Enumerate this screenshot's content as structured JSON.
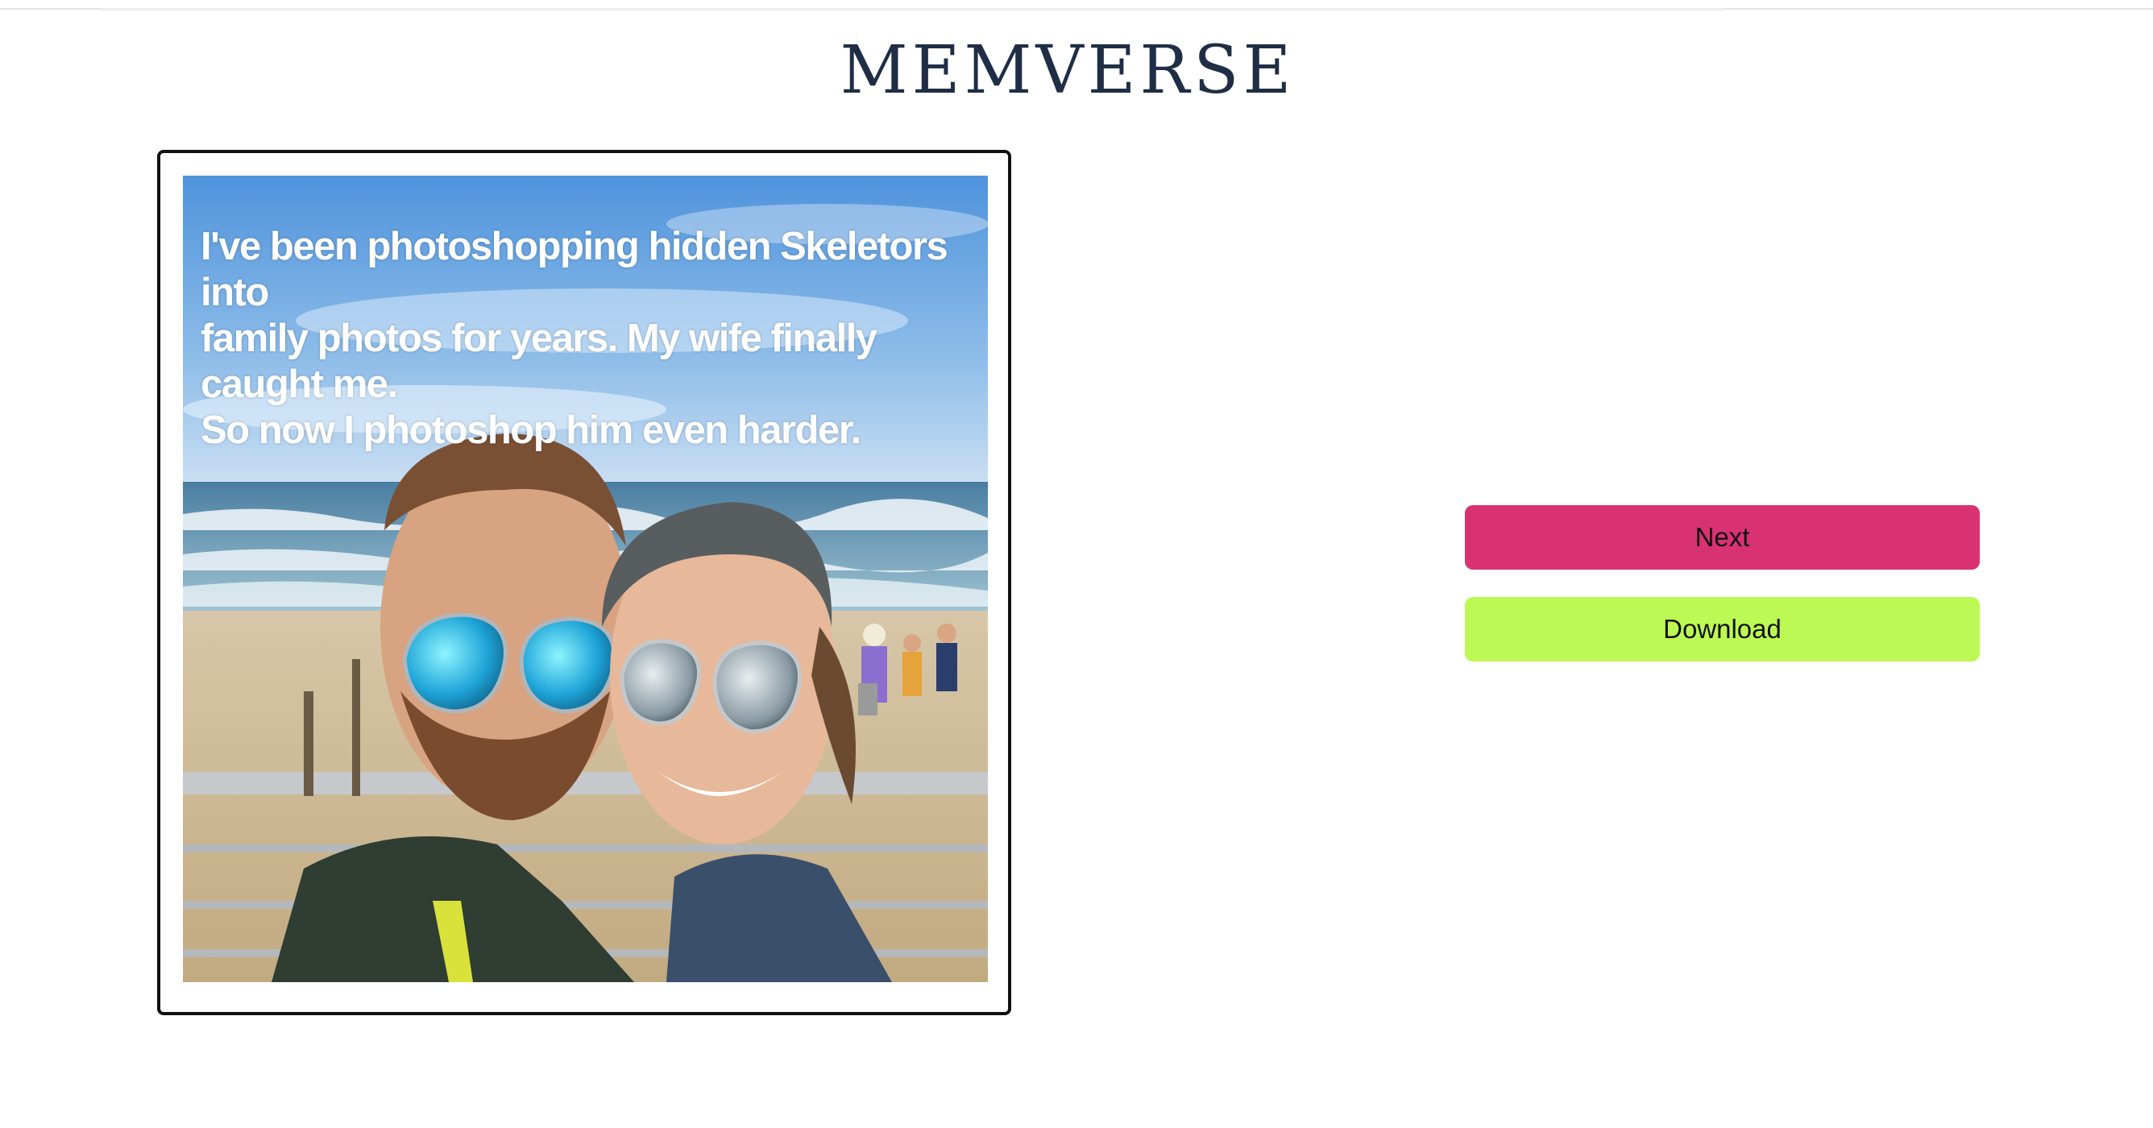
{
  "app": {
    "title": "MEMVERSE"
  },
  "meme": {
    "caption_line1": "I've been photoshopping hidden Skeletors into",
    "caption_line2": "family photos for years. My wife finally caught me.",
    "caption_line3": "So now I photoshop him even harder.",
    "image_description": "beach selfie photo"
  },
  "actions": {
    "next_label": "Next",
    "download_label": "Download"
  },
  "colors": {
    "next_button": "#d83272",
    "download_button": "#bdf954",
    "title_text": "#1f2e45"
  }
}
